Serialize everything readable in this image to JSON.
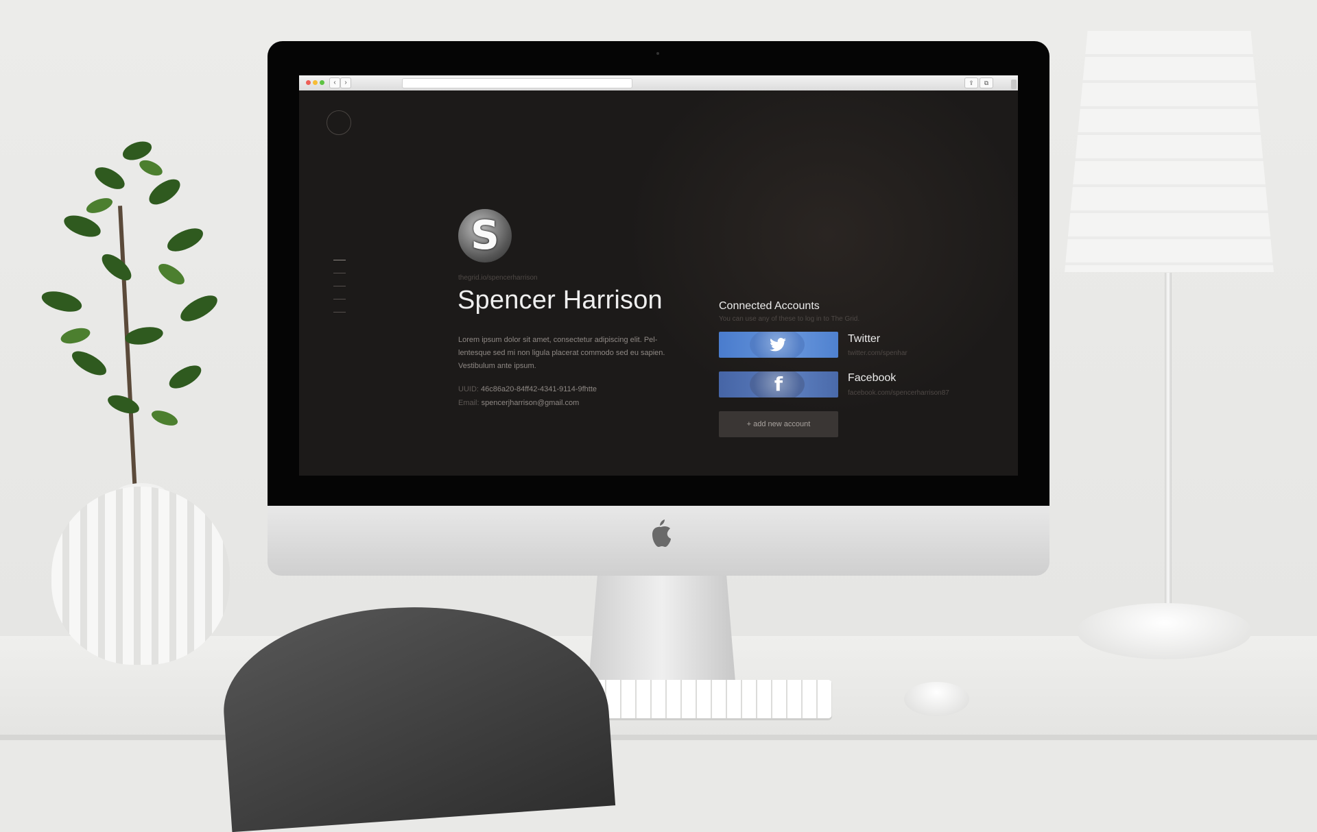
{
  "profile": {
    "avatar_letter": "S",
    "url": "thegrid.io/spencerharrison",
    "name": "Spencer Harrison",
    "bio": "Lorem ipsum dolor sit amet, consectetur adipiscing elit. Pel-lentesque sed mi non ligula placerat commodo sed eu sapien. Vestibulum ante ipsum.",
    "uuid_label": "UUID:",
    "uuid": "46c86a20-84ff42-4341-9114-9fhtte",
    "email_label": "Email:",
    "email": "spencerjharrison@gmail.com"
  },
  "accounts": {
    "title": "Connected Accounts",
    "subtitle": "You can use any of these to log in to The Grid.",
    "items": [
      {
        "name": "Twitter",
        "link": "twitter.com/spenhar",
        "icon": "twitter-bird-icon",
        "color": "#5a8ad6"
      },
      {
        "name": "Facebook",
        "link": "facebook.com/spencerharrison87",
        "icon": "facebook-f-icon",
        "icon_text": "f",
        "color": "#4f6fb1"
      }
    ],
    "add_label": "+ add new account"
  },
  "browser": {
    "back_icon": "‹",
    "forward_icon": "›"
  },
  "colors": {
    "page_background": "#1f1c1a",
    "twitter": "#5a8ad6",
    "facebook": "#4f6fb1"
  }
}
